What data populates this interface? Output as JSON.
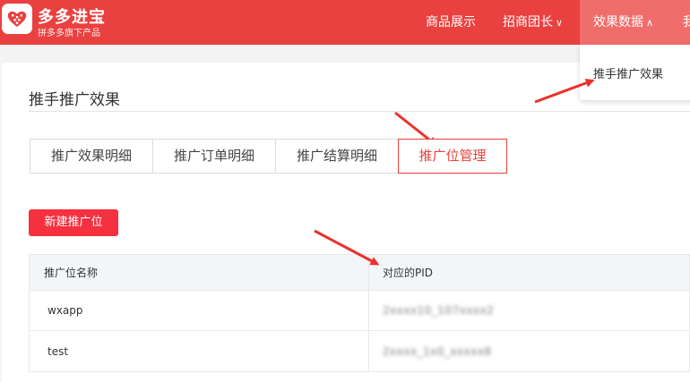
{
  "brand": {
    "name": "多多进宝",
    "subtitle": "拼多多旗下产品"
  },
  "nav": {
    "items": [
      {
        "label": "商品展示"
      },
      {
        "label": "招商团长",
        "chevron": "∨"
      },
      {
        "label": "效果数据",
        "chevron": "∧"
      },
      {
        "label": "我"
      }
    ]
  },
  "dropdown": {
    "item": "推手推广效果"
  },
  "page": {
    "title": "推手推广效果"
  },
  "tabs": [
    {
      "label": "推广效果明细"
    },
    {
      "label": "推广订单明细"
    },
    {
      "label": "推广结算明细"
    },
    {
      "label": "推广位管理"
    }
  ],
  "new_button": "新建推广位",
  "table": {
    "headers": [
      "推广位名称",
      "对应的PID"
    ],
    "rows": [
      {
        "name": "wxapp",
        "pid": "2xxxx10_107xxxx2"
      },
      {
        "name": "test",
        "pid": "2xxxx_1x0_xxxxx8"
      }
    ]
  },
  "colors": {
    "brand_red": "#e9413f",
    "button_red": "#f6313f",
    "arrow_red": "#e8322c"
  },
  "icons": {
    "logo": "pinduoduo-heart-logo",
    "annotation": "red-arrow"
  }
}
